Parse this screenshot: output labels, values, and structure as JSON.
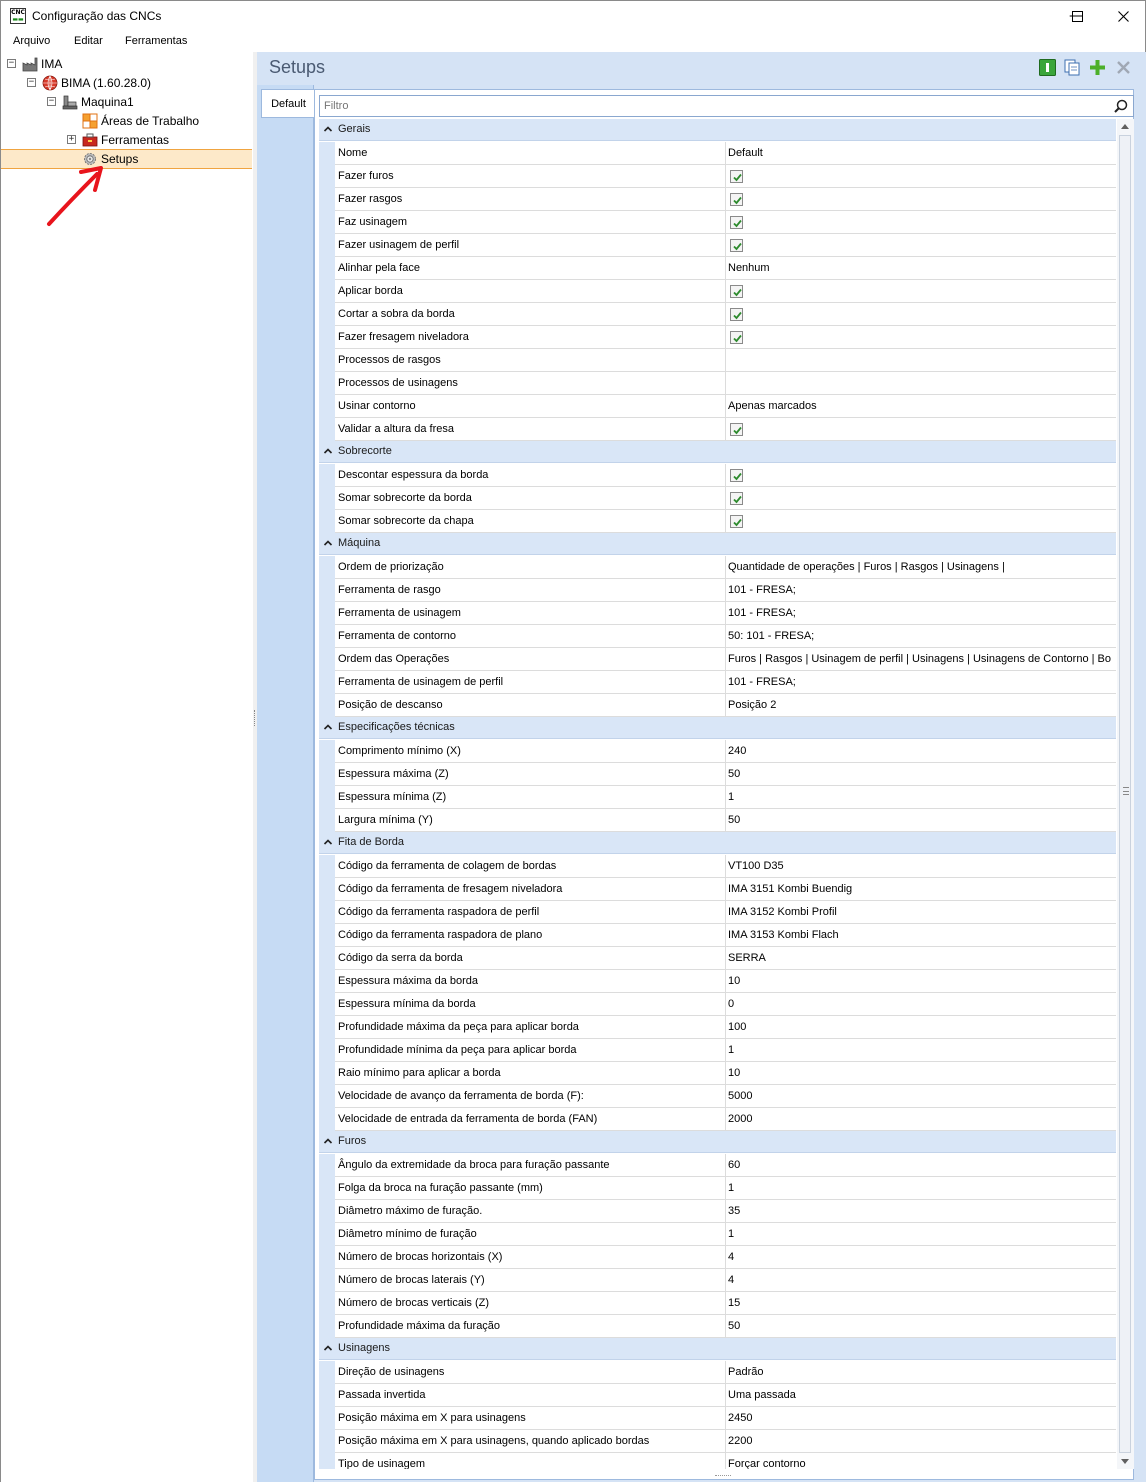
{
  "window": {
    "title": "Configuração das CNCs",
    "minimize_glyph": "—",
    "maximize_glyph": "☐",
    "close_glyph": "✕"
  },
  "menu": [
    "Arquivo",
    "Editar",
    "Ferramentas"
  ],
  "tree": {
    "nodes": [
      {
        "label": "IMA",
        "icon": "factory-icon",
        "level": 0,
        "expander": "−"
      },
      {
        "label": "BIMA (1.60.28.0)",
        "icon": "globe-icon",
        "level": 1,
        "expander": "−"
      },
      {
        "label": "Maquina1",
        "icon": "machine-icon",
        "level": 2,
        "expander": "−"
      },
      {
        "label": "Áreas de Trabalho",
        "icon": "work-areas-icon",
        "level": 3,
        "expander": ""
      },
      {
        "label": "Ferramentas",
        "icon": "toolbox-icon",
        "level": 3,
        "expander": "+"
      },
      {
        "label": "Setups",
        "icon": "gear-icon",
        "level": 3,
        "expander": "",
        "selected": true
      }
    ]
  },
  "panel": {
    "title": "Setups",
    "tab": "Default",
    "filter_placeholder": "Filtro",
    "toolbar_icons": [
      "info-icon",
      "copy-icon",
      "add-icon",
      "delete-icon"
    ]
  },
  "properties": [
    {
      "category": "Gerais",
      "items": [
        {
          "name": "Nome",
          "value": "Default"
        },
        {
          "name": "Fazer furos",
          "checked": true
        },
        {
          "name": "Fazer rasgos",
          "checked": true
        },
        {
          "name": "Faz usinagem",
          "checked": true
        },
        {
          "name": "Fazer usinagem de perfil",
          "checked": true
        },
        {
          "name": "Alinhar pela face",
          "value": "Nenhum"
        },
        {
          "name": "Aplicar borda",
          "checked": true
        },
        {
          "name": "Cortar a sobra da borda",
          "checked": true
        },
        {
          "name": "Fazer fresagem niveladora",
          "checked": true
        },
        {
          "name": "Processos de rasgos",
          "value": ""
        },
        {
          "name": "Processos de usinagens",
          "value": ""
        },
        {
          "name": "Usinar contorno",
          "value": "Apenas marcados"
        },
        {
          "name": "Validar a altura da fresa",
          "checked": true
        }
      ]
    },
    {
      "category": "Sobrecorte",
      "items": [
        {
          "name": "Descontar espessura da borda",
          "checked": true
        },
        {
          "name": "Somar sobrecorte da borda",
          "checked": true
        },
        {
          "name": "Somar sobrecorte da chapa",
          "checked": true
        }
      ]
    },
    {
      "category": "Máquina",
      "items": [
        {
          "name": "Ordem de priorização",
          "value": "Quantidade de operações | Furos | Rasgos | Usinagens |"
        },
        {
          "name": "Ferramenta de rasgo",
          "value": "101 - FRESA;"
        },
        {
          "name": "Ferramenta de usinagem",
          "value": "101 - FRESA;"
        },
        {
          "name": "Ferramenta de contorno",
          "value": "50: 101 - FRESA;"
        },
        {
          "name": "Ordem das Operações",
          "value": "Furos | Rasgos | Usinagem de perfil | Usinagens | Usinagens de Contorno | Bo"
        },
        {
          "name": "Ferramenta de usinagem de perfil",
          "value": "101 - FRESA;"
        },
        {
          "name": "Posição de descanso",
          "value": "Posição 2"
        }
      ]
    },
    {
      "category": "Especificações técnicas",
      "items": [
        {
          "name": "Comprimento mínimo (X)",
          "value": "240"
        },
        {
          "name": "Espessura máxima (Z)",
          "value": "50"
        },
        {
          "name": "Espessura mínima (Z)",
          "value": "1"
        },
        {
          "name": "Largura mínima (Y)",
          "value": "50"
        }
      ]
    },
    {
      "category": "Fita de Borda",
      "items": [
        {
          "name": "Código da ferramenta de colagem de bordas",
          "value": "VT100 D35"
        },
        {
          "name": "Código da ferramenta de fresagem niveladora",
          "value": "IMA 3151 Kombi Buendig"
        },
        {
          "name": "Código da ferramenta raspadora de perfil",
          "value": "IMA 3152 Kombi Profil"
        },
        {
          "name": "Código da ferramenta raspadora de plano",
          "value": "IMA 3153 Kombi Flach"
        },
        {
          "name": "Código da serra da borda",
          "value": "SERRA"
        },
        {
          "name": "Espessura máxima da borda",
          "value": "10"
        },
        {
          "name": "Espessura mínima da borda",
          "value": "0"
        },
        {
          "name": "Profundidade máxima da peça para aplicar borda",
          "value": "100"
        },
        {
          "name": "Profundidade mínima da peça para aplicar borda",
          "value": "1"
        },
        {
          "name": "Raio mínimo para aplicar a borda",
          "value": "10"
        },
        {
          "name": "Velocidade de avanço da ferramenta de borda (F):",
          "value": "5000"
        },
        {
          "name": "Velocidade de entrada da ferramenta de borda (FAN)",
          "value": "2000"
        }
      ]
    },
    {
      "category": "Furos",
      "items": [
        {
          "name": "Ângulo da extremidade da broca para furação passante",
          "value": "60"
        },
        {
          "name": "Folga da broca na furação passante (mm)",
          "value": "1"
        },
        {
          "name": "Diâmetro máximo de furação.",
          "value": "35"
        },
        {
          "name": "Diâmetro mínimo de furação",
          "value": "1"
        },
        {
          "name": "Número de brocas horizontais (X)",
          "value": "4"
        },
        {
          "name": "Número de brocas laterais (Y)",
          "value": "4"
        },
        {
          "name": "Número de brocas verticais (Z)",
          "value": "15"
        },
        {
          "name": "Profundidade máxima da furação",
          "value": "50"
        }
      ]
    },
    {
      "category": "Usinagens",
      "items": [
        {
          "name": "Direção de usinagens",
          "value": "Padrão"
        },
        {
          "name": "Passada invertida",
          "value": "Uma passada"
        },
        {
          "name": "Posição máxima em X para usinagens",
          "value": "2450"
        },
        {
          "name": "Posição máxima em X para usinagens, quando aplicado bordas",
          "value": "2200"
        },
        {
          "name": "Tipo de usinagem",
          "value": "Forçar contorno"
        }
      ]
    }
  ],
  "colors": {
    "selection": "#fde9c9",
    "selection_border": "#f0a440",
    "category_bg": "#d9e6f7",
    "pane_bg": "#d5e3f5",
    "check": "#2e8b2e",
    "annotation_arrow": "#e8141c"
  }
}
